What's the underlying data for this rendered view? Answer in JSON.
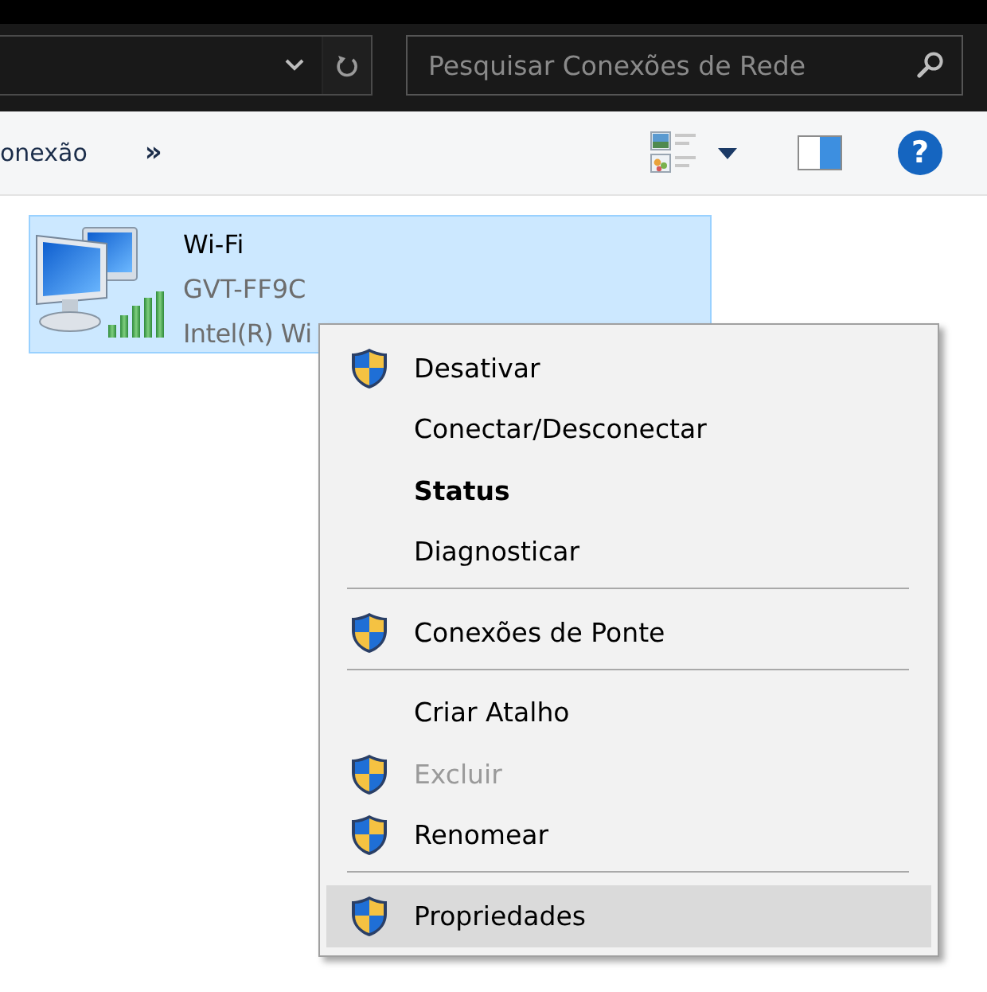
{
  "search": {
    "placeholder": "Pesquisar Conexões de Rede"
  },
  "toolbar": {
    "commands": [
      {
        "label": "onexão"
      },
      {
        "label": "»"
      }
    ],
    "help": {
      "label": "?"
    }
  },
  "connections": [
    {
      "name": "Wi-Fi",
      "network": "GVT-FF9C",
      "adapter": "Intel(R) Wi",
      "selected": true
    }
  ],
  "context_menu": {
    "items": [
      {
        "kind": "command",
        "label": "Desativar",
        "shield": true,
        "default": false,
        "disabled": false,
        "selected": false
      },
      {
        "kind": "command",
        "label": "Conectar/Desconectar",
        "shield": false,
        "default": false,
        "disabled": false,
        "selected": false
      },
      {
        "kind": "command",
        "label": "Status",
        "shield": false,
        "default": true,
        "disabled": false,
        "selected": false
      },
      {
        "kind": "command",
        "label": "Diagnosticar",
        "shield": false,
        "default": false,
        "disabled": false,
        "selected": false
      },
      {
        "kind": "separator"
      },
      {
        "kind": "command",
        "label": "Conexões de Ponte",
        "shield": true,
        "default": false,
        "disabled": false,
        "selected": false
      },
      {
        "kind": "separator"
      },
      {
        "kind": "command",
        "label": "Criar Atalho",
        "shield": false,
        "default": false,
        "disabled": false,
        "selected": false
      },
      {
        "kind": "command",
        "label": "Excluir",
        "shield": true,
        "default": false,
        "disabled": true,
        "selected": false
      },
      {
        "kind": "command",
        "label": "Renomear",
        "shield": true,
        "default": false,
        "disabled": false,
        "selected": false
      },
      {
        "kind": "separator"
      },
      {
        "kind": "command",
        "label": "Propriedades",
        "shield": true,
        "default": false,
        "disabled": false,
        "selected": true
      }
    ]
  }
}
